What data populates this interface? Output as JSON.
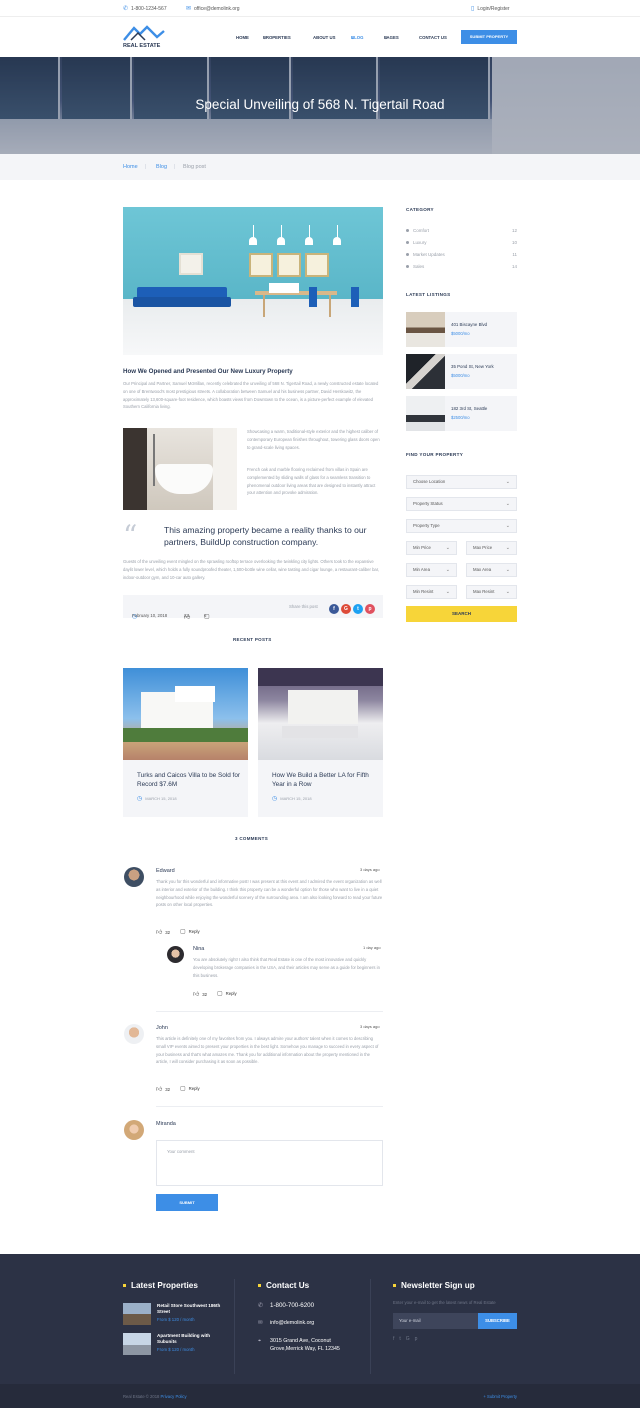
{
  "topbar": {
    "phone": "1-800-1234-567",
    "email": "office@demolink.org",
    "login": "Login/Register"
  },
  "logo": {
    "text": "REAL ESTATE"
  },
  "nav": {
    "items": [
      "HOME",
      "PROPERTIES",
      "ABOUT US",
      "BLOG",
      "PAGES",
      "CONTACT US"
    ],
    "active": "BLOG",
    "submit": "SUBMIT PROPERTY"
  },
  "hero": {
    "title": "Special Unveiling of 568 N. Tigertail Road"
  },
  "breadcrumbs": [
    "Home",
    "Blog",
    "Blog post"
  ],
  "article": {
    "heading": "How We Opened and Presented Our New Luxury Property",
    "p1": "Our Principal and Partner, Samuel McMillan, recently celebrated the unveiling of 568 N. Tigertail Road, a newly constructed estate located on one of Brentwood’s most prestigious streets. A collaboration between Samuel and his business partner, David Herskowitz, the approximately 13,600-square-foot residence, which boasts views from Downtown to the ocean, is a picture-perfect example of elevated Southern California living.",
    "p2": "Showcasing a warm, traditional-style exterior and the highest caliber of contemporary European finishes throughout, towering glass doors open to grand-scale living spaces.",
    "p3": "French oak and marble flooring reclaimed from villas in Spain are complemented by sliding walls of glass for a seamless transition to phenomenal outdoor living areas that are designed to instantly attract your attention and provoke admiration.",
    "quote": "This amazing property became a reality thanks to our partners, BuildUp construction company.",
    "p4": "Guests of the unveiling event mingled on the sprawling rooftop terrace overlooking the twinkling city lights. Others took to the expansive daylit lower level, which holds a fully soundproofed theater, 1,500-bottle wine cellar, wine tasting and cigar lounge, a restaurant-caliber bar, indoor-outdoor gym, and 10-car auto gallery.",
    "date": "February 10, 2018",
    "likes": "23",
    "comments_count": "6",
    "share_label": "Share this post"
  },
  "recent": {
    "title": "RECENT POSTS",
    "posts": [
      {
        "title": "Turks and Caicos Villa to be Sold for Record $7.6M",
        "date": "MARCH 15, 2018"
      },
      {
        "title": "How We Build a Better LA for Fifth Year in a Row",
        "date": "MARCH 15, 2018"
      }
    ]
  },
  "comments": {
    "title": "3 COMMENTS",
    "items": [
      {
        "name": "Edward",
        "date": "3 days ago",
        "text": "Thank you for this wonderful and informative post! I was present at this event and I admired the event organization as well as interior and exterior of the building. I think this property can be a wonderful option for those who want to live in a quiet neighbourhood while enjoying the wonderful scenery of the surrounding area. I am also looking forward to read your future posts on other local properties.",
        "likes": "32",
        "reply": "Reply"
      },
      {
        "name": "Nina",
        "date": "1 day ago",
        "text": "You are absolutely right! I also think that Real Estate is one of the most innovative and quickly developing brokerage companies in the USA, and their articles may serve as a guide for beginners in this business.",
        "likes": "32",
        "reply": "Reply"
      },
      {
        "name": "John",
        "date": "3 days ago",
        "text": "This article is definitely one of my favorites from you. I always admire your authors’ talent when it comes to describing small VIP events aimed to present your properties in the best light. Somehow you manage to succeed in every aspect of your business and that’s what amazes me. Thank you for additional information about the property mentioned in the article, I will consider purchasing it as soon as possible.",
        "likes": "32",
        "reply": "Reply"
      }
    ],
    "form": {
      "name": "Miranda",
      "placeholder": "Your comment",
      "submit": "SUBMIT"
    }
  },
  "sidebar": {
    "category_title": "CATEGORY",
    "categories": [
      {
        "name": "Comfort",
        "count": "12"
      },
      {
        "name": "Luxury",
        "count": "10"
      },
      {
        "name": "Market Updates",
        "count": "11"
      },
      {
        "name": "Sales",
        "count": "14"
      }
    ],
    "listings_title": "LATEST LISTINGS",
    "listings": [
      {
        "address": "401 Biscayne Blvd",
        "price": "$5000/mo"
      },
      {
        "address": "35 Pond St, New York",
        "price": "$5000/mo"
      },
      {
        "address": "182 3rd St, Seattle",
        "price": "$2500/mo"
      }
    ],
    "find_title": "FIND YOUR PROPERTY",
    "fields": {
      "location": "Choose Location",
      "status": "Property Status",
      "type": "Property Type",
      "min_price": "Min Price",
      "max_price": "Max Price",
      "min_area": "Min Area",
      "max_area": "Max Area",
      "min_resint": "Min Resint",
      "max_resint": "Max Resint"
    },
    "search": "SEARCH"
  },
  "footer": {
    "latest_title": "Latest Properties",
    "properties": [
      {
        "name": "Retail Store Southwest 186th Street",
        "price": "From $ 120 / month"
      },
      {
        "name": "Apartment Building with Subunits",
        "price": "From $ 120 / month"
      }
    ],
    "contact_title": "Contact Us",
    "phone": "1-800-700-6200",
    "email": "info@demolink.org",
    "address": "3015 Grand Ave, Coconut Grove,Merrick Way, FL 12345",
    "newsletter_title": "Newsletter Sign up",
    "newsletter_note": "Enter your e-mail to get the latest news of Real Estate",
    "email_placeholder": "Your e-mail",
    "subscribe": "SUBSCRIBE",
    "copyright": "Real Estate © 2018",
    "privacy": "Privacy Policy",
    "submit_property": "+ Submit Property"
  },
  "colors": {
    "accent": "#3d8ee6",
    "search": "#f7d539",
    "footer": "#2c3245"
  }
}
